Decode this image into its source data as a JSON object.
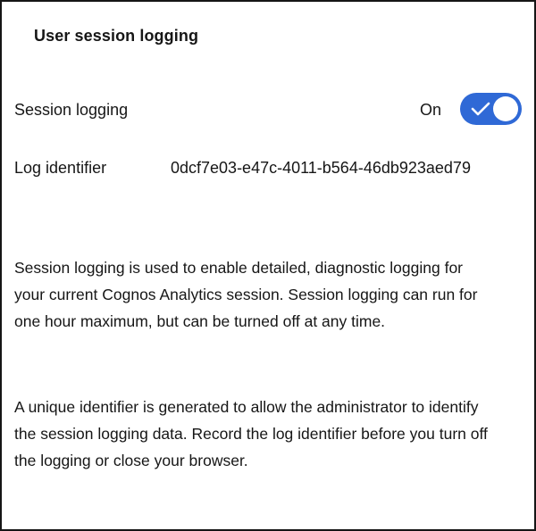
{
  "panel": {
    "title": "User session logging"
  },
  "session_logging": {
    "label": "Session logging",
    "state_text": "On",
    "enabled": true,
    "toggle_color": "#2f69d6"
  },
  "log_identifier": {
    "label": "Log identifier",
    "value": "0dcf7e03-e47c-4011-b564-46db923aed79"
  },
  "description": {
    "paragraph_1": "Session logging is used to enable detailed, diagnostic logging for your current Cognos Analytics session. Session logging can run for one hour maximum, but can be turned off at any time.",
    "paragraph_2": "A unique identifier is generated to allow the administrator to identify the session logging data. Record the log identifier before you turn off the logging or close your browser."
  },
  "icons": {
    "toggle_check": "checkmark-icon"
  }
}
